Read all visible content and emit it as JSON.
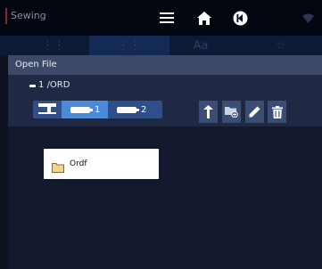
{
  "header": {
    "title": "Sewing",
    "icons": [
      "menu-icon",
      "home-icon",
      "back-icon",
      "wifi-icon"
    ]
  },
  "tabs": [
    {
      "icon": "stitch-icon"
    },
    {
      "icon": "embroidery-icon"
    },
    {
      "text": "Aa"
    },
    {
      "icon": "star-icon"
    }
  ],
  "dialog": {
    "title": "Open File",
    "path": {
      "index": "1",
      "text": "/ORD"
    },
    "devices": [
      {
        "icon": "machine-icon"
      },
      {
        "icon": "usb-icon",
        "label": "1",
        "selected": true
      },
      {
        "icon": "usb-icon",
        "label": "2"
      }
    ],
    "actions": [
      "folder-up-icon",
      "new-folder-icon",
      "rename-icon",
      "delete-icon"
    ],
    "items": [
      {
        "type": "folder",
        "name": "Ordf"
      }
    ]
  },
  "colors": {
    "background": "#0d1120",
    "dialog_header": "#3d4968",
    "panel": "#1f2943",
    "device_selected": "#4a8ad6",
    "action_button": "#3a4e75",
    "folder": "#f2d58a"
  }
}
